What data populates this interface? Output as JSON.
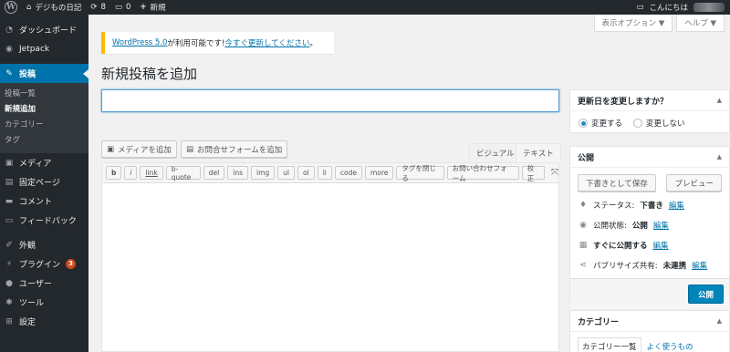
{
  "adminbar": {
    "site_name": "デジもの日記",
    "updates_count": "8",
    "comments_count": "0",
    "new_label": "新規",
    "greeting": "こんにちは"
  },
  "menu": {
    "dashboard": "ダッシュボード",
    "jetpack": "Jetpack",
    "posts": "投稿",
    "posts_sub": [
      "投稿一覧",
      "新規追加",
      "カテゴリー",
      "タグ"
    ],
    "media": "メディア",
    "pages": "固定ページ",
    "comments": "コメント",
    "feedback": "フィードバック",
    "appearance": "外観",
    "plugins": "プラグイン",
    "plugins_badge": "3",
    "users": "ユーザー",
    "tools": "ツール",
    "settings": "設定"
  },
  "screen_meta": {
    "screen_options": "表示オプション ▼",
    "help": "ヘルプ ▼"
  },
  "notice": {
    "link_version": "WordPress 5.0",
    "text_middle": " が利用可能です! ",
    "link_update": "今すぐ更新してください",
    "text_end": "。"
  },
  "page_title": "新規投稿を追加",
  "editor": {
    "add_media": "メディアを追加",
    "add_form": "お問合せフォームを追加",
    "tab_visual": "ビジュアル",
    "tab_text": "テキスト",
    "quicktags": [
      "b",
      "i",
      "link",
      "b-quote",
      "del",
      "ins",
      "img",
      "ul",
      "ol",
      "li",
      "code",
      "more",
      "タグを閉じる",
      "お問い合わせフォーム",
      "校正"
    ]
  },
  "update_box": {
    "title": "更新日を変更しますか？",
    "option_change": "変更する",
    "option_nochange": "変更しない"
  },
  "publish_box": {
    "title": "公開",
    "save_draft": "下書きとして保存",
    "preview": "プレビュー",
    "status_label": "ステータス: ",
    "status_value": "下書き",
    "visibility_label": "公開状態: ",
    "visibility_value": "公開",
    "schedule_label": "すぐに公開する",
    "publicize_label": "パブリサイズ共有: ",
    "publicize_value": "未連携",
    "edit": "編集",
    "publish": "公開"
  },
  "category_box": {
    "title": "カテゴリー",
    "tab_all": "カテゴリー一覧",
    "tab_popular": "よく使うもの"
  },
  "colors": {
    "adminbar_bg": "#23282d",
    "accent": "#0073aa",
    "notice_warning": "#ffb900",
    "primary_button": "#0085ba",
    "badge": "#ca4a1f"
  }
}
